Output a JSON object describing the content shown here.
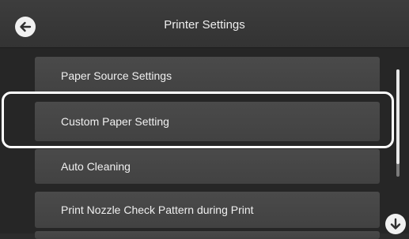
{
  "header": {
    "title": "Printer Settings",
    "back_icon": "arrow-left-icon"
  },
  "menu": {
    "items": [
      {
        "label": "Paper Source Settings"
      },
      {
        "label": "Custom Paper Setting",
        "highlighted": true
      },
      {
        "label": "Auto Cleaning"
      },
      {
        "label": "Print Nozzle Check Pattern during Print"
      },
      {
        "label": ""
      }
    ]
  },
  "scroll": {
    "down_icon": "arrow-down-icon"
  },
  "colors": {
    "header_bg": "#3a3a3a",
    "list_bg": "#262626",
    "item_bg": "#464646",
    "text": "#f0f0f0",
    "highlight": "#ffffff"
  }
}
